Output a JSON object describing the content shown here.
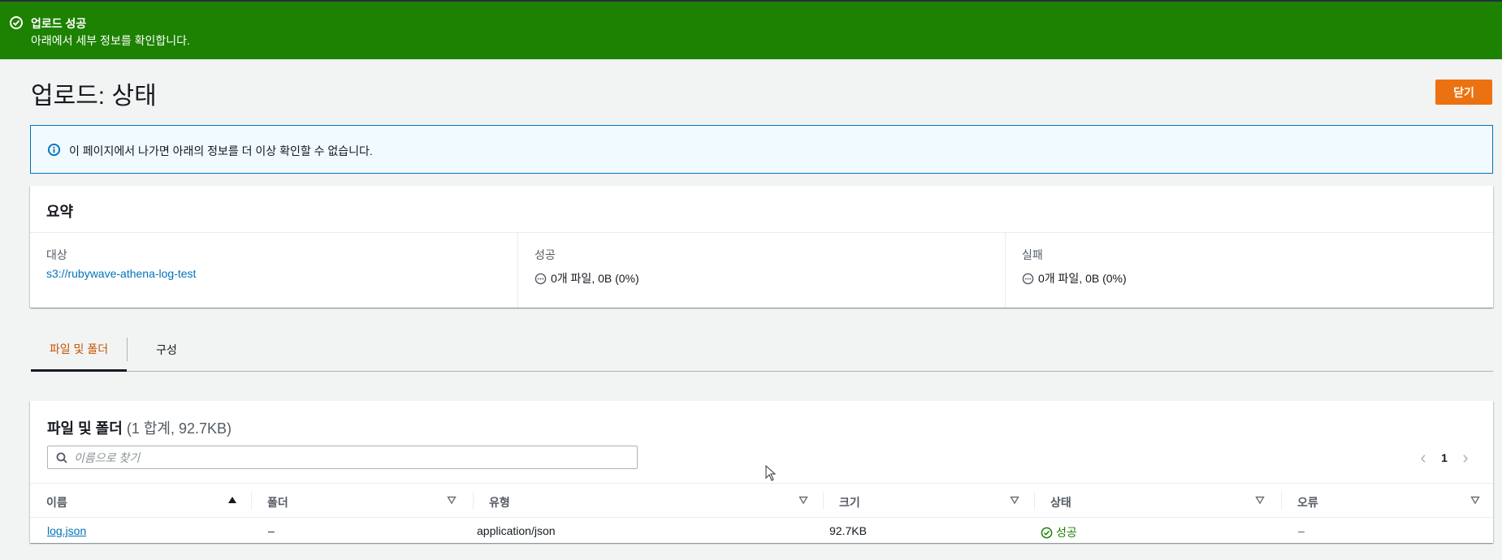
{
  "banner": {
    "title": "업로드 성공",
    "subtitle": "아래에서 세부 정보를 확인합니다.",
    "icon": "check-circle-icon",
    "color": "#1d8102"
  },
  "page": {
    "title": "업로드: 상태",
    "close_label": "닫기",
    "accent_color": "#ec7211"
  },
  "info": {
    "message": "이 페이지에서 나가면 아래의 정보를 더 이상 확인할 수 없습니다.",
    "icon": "info-icon"
  },
  "summary": {
    "title": "요약",
    "destination_label": "대상",
    "destination_value": "s3://rubywave-athena-log-test",
    "success_label": "성공",
    "success_value": "0개 파일, 0B (0%)",
    "failure_label": "실패",
    "failure_value": "0개 파일, 0B (0%)"
  },
  "tabs": [
    {
      "label": "파일 및 폴더",
      "active": true
    },
    {
      "label": "구성",
      "active": false
    }
  ],
  "files": {
    "title": "파일 및 폴더",
    "count": "(1 합계, 92.7KB)",
    "search_placeholder": "이름으로 찾기",
    "page_number": "1",
    "columns": [
      "이름",
      "폴더",
      "유형",
      "크기",
      "상태",
      "오류"
    ],
    "rows": [
      {
        "name": "log.json",
        "folder": "–",
        "type": "application/json",
        "size": "92.7KB",
        "status": "성공",
        "error": "–"
      }
    ]
  }
}
